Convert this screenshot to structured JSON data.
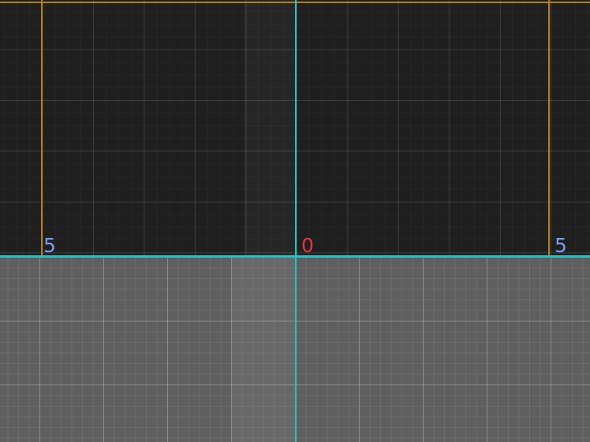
{
  "labels": {
    "left": "5",
    "origin": "0",
    "right": "5"
  },
  "colors": {
    "background_dark": "#1f1f1f",
    "ground_plane": "#5f5f5f",
    "axis": "#23c2c8",
    "boundary": "#b3801e",
    "label_side": "#7b9cf2",
    "label_origin": "#e2383c"
  }
}
